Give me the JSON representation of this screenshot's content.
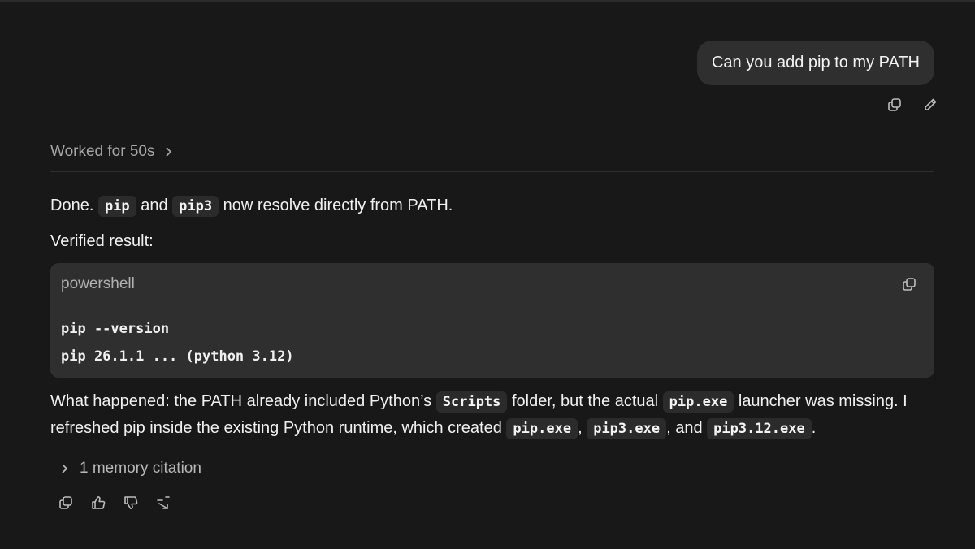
{
  "user_message": {
    "text": "Can you add pip to my PATH",
    "actions": [
      "copy-icon",
      "edit-icon"
    ]
  },
  "worked": {
    "label": "Worked for 50s"
  },
  "response": {
    "line1": {
      "pre": "Done. ",
      "code1": "pip",
      "mid": " and ",
      "code2": "pip3",
      "post": " now resolve directly from PATH."
    },
    "line2": "Verified result:",
    "codeblock": {
      "language": "powershell",
      "lines": [
        "pip --version",
        "pip 26.1.1 ... (python 3.12)"
      ]
    },
    "explanation": {
      "t1": "What happened: the PATH already included Python’s ",
      "c1": "Scripts",
      "t2": " folder, but the actual ",
      "c2": "pip.exe",
      "t3": " launcher was missing. I refreshed pip inside the existing Python runtime, which created ",
      "c3": "pip.exe",
      "t4": ", ",
      "c4": "pip3.exe",
      "t5": ", and ",
      "c5": "pip3.12.exe",
      "t6": "."
    },
    "citation": "1 memory citation"
  },
  "message_actions": [
    "copy-icon",
    "thumbs-up-icon",
    "thumbs-down-icon",
    "share-icon"
  ]
}
